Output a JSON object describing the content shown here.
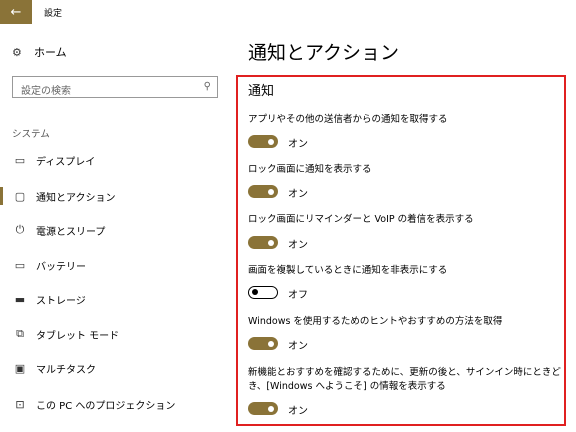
{
  "app": {
    "title": "設定"
  },
  "sidebar": {
    "home_label": "ホーム",
    "search_placeholder": "設定の検索",
    "section_label": "システム",
    "items": [
      {
        "label": "ディスプレイ",
        "icon": "monitor-icon"
      },
      {
        "label": "通知とアクション",
        "icon": "notification-icon",
        "active": true
      },
      {
        "label": "電源とスリープ",
        "icon": "power-icon"
      },
      {
        "label": "バッテリー",
        "icon": "battery-icon"
      },
      {
        "label": "ストレージ",
        "icon": "storage-icon"
      },
      {
        "label": "タブレット モード",
        "icon": "tablet-icon"
      },
      {
        "label": "マルチタスク",
        "icon": "multitask-icon"
      },
      {
        "label": "この PC へのプロジェクション",
        "icon": "projection-icon"
      }
    ]
  },
  "main": {
    "title": "通知とアクション",
    "section_title": "通知",
    "settings": [
      {
        "label": "アプリやその他の送信者からの通知を取得する",
        "state": "オン",
        "on": true
      },
      {
        "label": "ロック画面に通知を表示する",
        "state": "オン",
        "on": true
      },
      {
        "label": "ロック画面にリマインダーと VoIP の着信を表示する",
        "state": "オン",
        "on": true
      },
      {
        "label": "画面を複製しているときに通知を非表示にする",
        "state": "オフ",
        "on": false
      },
      {
        "label": "Windows を使用するためのヒントやおすすめの方法を取得",
        "state": "オン",
        "on": true
      },
      {
        "label": "新機能とおすすめを確認するために、更新の後と、サインイン時にときどき、[Windows へようこそ] の情報を表示する",
        "state": "オン",
        "on": true
      }
    ]
  },
  "colors": {
    "accent": "#8a7338",
    "highlight_box": "#e02020"
  }
}
